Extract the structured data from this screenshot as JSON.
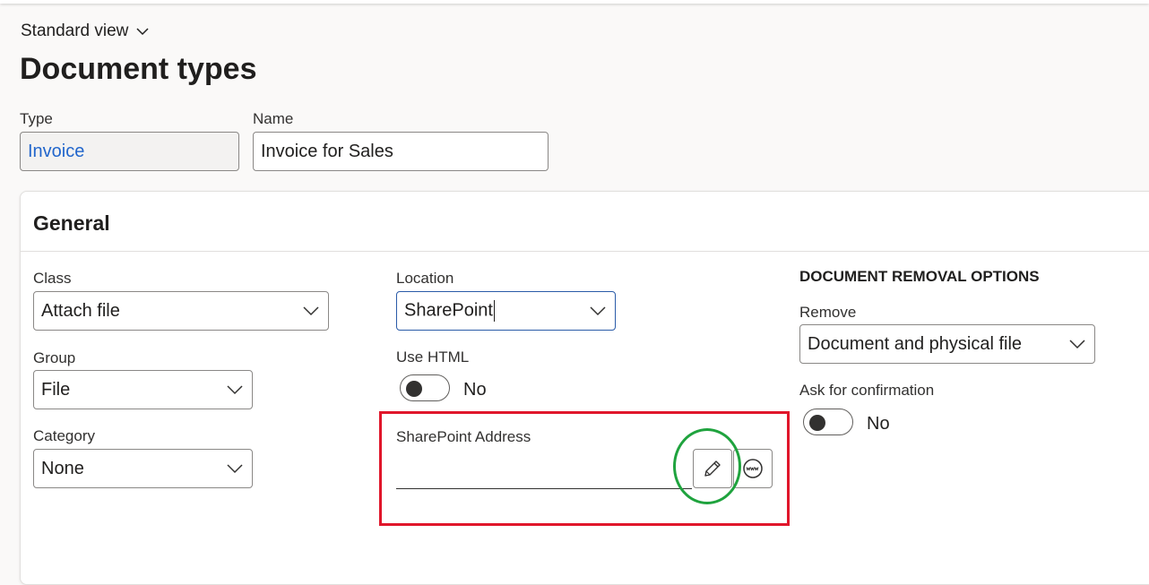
{
  "header": {
    "view_label": "Standard view",
    "page_title": "Document types"
  },
  "top_fields": {
    "type_label": "Type",
    "type_value": "Invoice",
    "name_label": "Name",
    "name_value": "Invoice for Sales"
  },
  "general": {
    "title": "General",
    "class_label": "Class",
    "class_value": "Attach file",
    "group_label": "Group",
    "group_value": "File",
    "category_label": "Category",
    "category_value": "None",
    "location_label": "Location",
    "location_value": "SharePoint",
    "use_html_label": "Use HTML",
    "use_html_value": "No",
    "sharepoint_address_label": "SharePoint Address",
    "sharepoint_address_value": ""
  },
  "removal": {
    "section_title": "DOCUMENT REMOVAL OPTIONS",
    "remove_label": "Remove",
    "remove_value": "Document and physical file",
    "ask_label": "Ask for confirmation",
    "ask_value": "No"
  },
  "annotations": {
    "highlight_box_color": "#e0162b",
    "highlight_circle_color": "#1fa33e"
  },
  "icons": {
    "view_chevron": "chevron-down-icon",
    "dropdown": "chevron-down-icon",
    "edit": "pencil-icon",
    "browse": "www-globe-icon"
  }
}
